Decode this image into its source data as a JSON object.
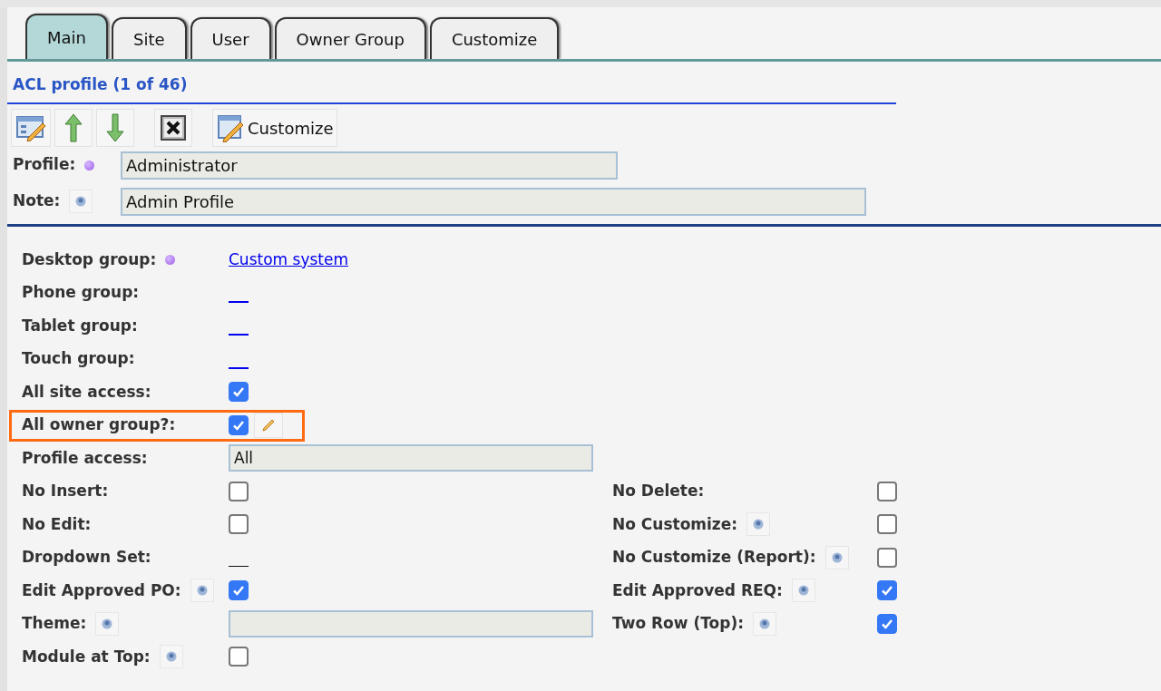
{
  "tabs": [
    {
      "label": "Main",
      "selected": true
    },
    {
      "label": "Site",
      "selected": false
    },
    {
      "label": "User",
      "selected": false
    },
    {
      "label": "Owner Group",
      "selected": false
    },
    {
      "label": "Customize",
      "selected": false
    }
  ],
  "title": "ACL profile (1 of 46)",
  "toolbar": [
    {
      "kind": "edit"
    },
    {
      "kind": "up"
    },
    {
      "kind": "down"
    },
    {
      "kind": "delete"
    },
    {
      "kind": "customize",
      "label": "Customize"
    }
  ],
  "header_fields": [
    {
      "label": "Profile:",
      "required": true,
      "value": "Administrator",
      "kind": "short"
    },
    {
      "label": "Note:",
      "help": true,
      "value": "Admin Profile",
      "kind": "long"
    }
  ],
  "rows": [
    {
      "left": {
        "label": "Desktop group:",
        "required": true,
        "kind": "link",
        "value": "Custom system"
      }
    },
    {
      "left": {
        "label": "Phone group:",
        "kind": "empty-link"
      }
    },
    {
      "left": {
        "label": "Tablet group:",
        "kind": "empty-link"
      }
    },
    {
      "left": {
        "label": "Touch group:",
        "kind": "empty-link"
      }
    },
    {
      "left": {
        "label": "All site access:",
        "kind": "checkbox",
        "checked": true
      }
    },
    {
      "left": {
        "label": "All owner group?:",
        "kind": "checkbox",
        "checked": true,
        "edit_button": true,
        "highlighted": true
      }
    },
    {
      "left": {
        "label": "Profile access:",
        "kind": "text",
        "value": "All"
      }
    },
    {
      "left": {
        "label": "No Insert:",
        "kind": "checkbox",
        "checked": false
      },
      "right": {
        "label": "No Delete:",
        "kind": "checkbox",
        "checked": false
      }
    },
    {
      "left": {
        "label": "No Edit:",
        "kind": "checkbox",
        "checked": false
      },
      "right": {
        "label": "No Customize:",
        "help": true,
        "kind": "checkbox",
        "checked": false
      }
    },
    {
      "left": {
        "label": "Dropdown Set:",
        "kind": "empty-value"
      },
      "right": {
        "label": "No Customize (Report):",
        "help": true,
        "kind": "checkbox",
        "checked": false
      }
    },
    {
      "left": {
        "label": "Edit Approved PO:",
        "help": true,
        "kind": "checkbox",
        "checked": true
      },
      "right": {
        "label": "Edit Approved REQ:",
        "help": true,
        "kind": "checkbox",
        "checked": true
      }
    },
    {
      "left": {
        "label": "Theme:",
        "help": true,
        "kind": "empty-text"
      },
      "right": {
        "label": "Two Row (Top):",
        "help": true,
        "kind": "checkbox",
        "checked": true
      }
    },
    {
      "left": {
        "label": "Module at Top:",
        "help": true,
        "kind": "checkbox",
        "checked": false
      }
    }
  ]
}
